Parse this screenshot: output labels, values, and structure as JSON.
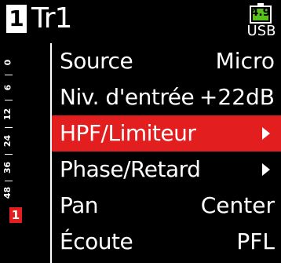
{
  "header": {
    "track_number": "1",
    "track_name": "Tr1",
    "battery_value": "4.9",
    "power_source": "USB"
  },
  "meter": {
    "scale_labels": [
      "0",
      "6",
      "12",
      "24",
      "36",
      "48"
    ],
    "channel": "1"
  },
  "menu": {
    "items": [
      {
        "label": "Source",
        "value": "Micro"
      },
      {
        "label": "Niv. d'entrée",
        "value": "+22dB"
      },
      {
        "label": "HPF/Limiteur",
        "value": ""
      },
      {
        "label": "Phase/Retard",
        "value": ""
      },
      {
        "label": "Pan",
        "value": "Center"
      },
      {
        "label": "Écoute",
        "value": "PFL"
      }
    ],
    "selected_index": 2
  },
  "colors": {
    "highlight": "#e31e1e",
    "battery": "#5ac01e",
    "background": "#000000"
  }
}
